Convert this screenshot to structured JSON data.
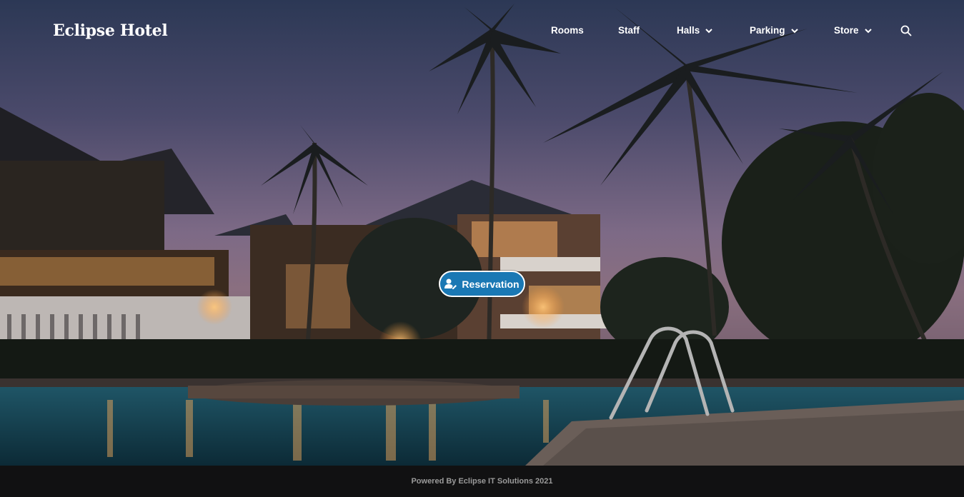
{
  "brand": {
    "name": "Eclipse Hotel"
  },
  "nav": {
    "items": [
      {
        "label": "Rooms",
        "has_dropdown": false
      },
      {
        "label": "Staff",
        "has_dropdown": false
      },
      {
        "label": "Halls",
        "has_dropdown": true
      },
      {
        "label": "Parking",
        "has_dropdown": true
      },
      {
        "label": "Store",
        "has_dropdown": true
      }
    ],
    "search_icon": "search-icon"
  },
  "hero": {
    "reservation_label": "Reservation",
    "reservation_icon": "user-edit-icon",
    "accent_color": "#1a78b4"
  },
  "footer": {
    "text": "Powered By Eclipse IT Solutions 2021"
  }
}
